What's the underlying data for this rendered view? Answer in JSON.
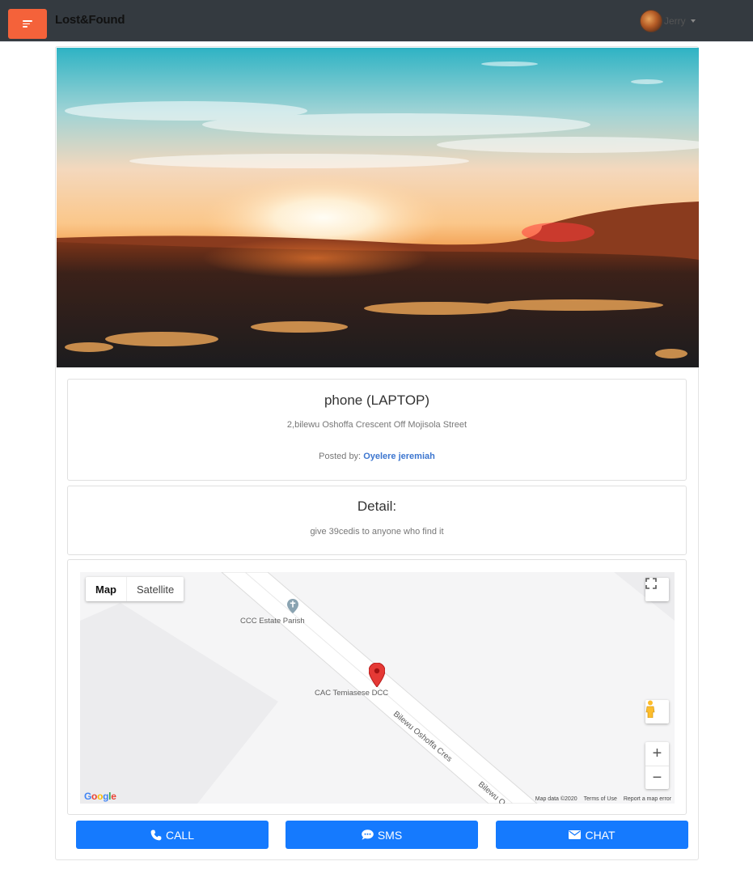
{
  "app": {
    "title": "Lost&Found"
  },
  "user": {
    "name": "Jerry"
  },
  "item": {
    "title": "phone (LAPTOP)",
    "address": "2,bilewu Oshoffa Crescent Off Mojisola Street",
    "posted_by_label": "Posted by:",
    "posted_by_name": "Oyelere jeremiah"
  },
  "detail": {
    "heading": "Detail:",
    "text": "give 39cedis to anyone who find it"
  },
  "map": {
    "type_map": "Map",
    "type_satellite": "Satellite",
    "places": [
      "CCC Estate Parish",
      "CAC Temiasese DCC"
    ],
    "streets": [
      "Bilewu Oshoffa Cres",
      "Bilewu O"
    ],
    "footer": [
      "Map data ©2020",
      "Terms of Use",
      "Report a map error"
    ],
    "zoom_in": "+",
    "zoom_out": "−",
    "logo": "Google"
  },
  "actions": {
    "call": "CALL",
    "sms": "SMS",
    "chat": "CHAT"
  },
  "colors": {
    "menu_button": "#f4623a",
    "action_button": "#157afe",
    "link": "#3d76cf",
    "topbar": "#343a40"
  }
}
